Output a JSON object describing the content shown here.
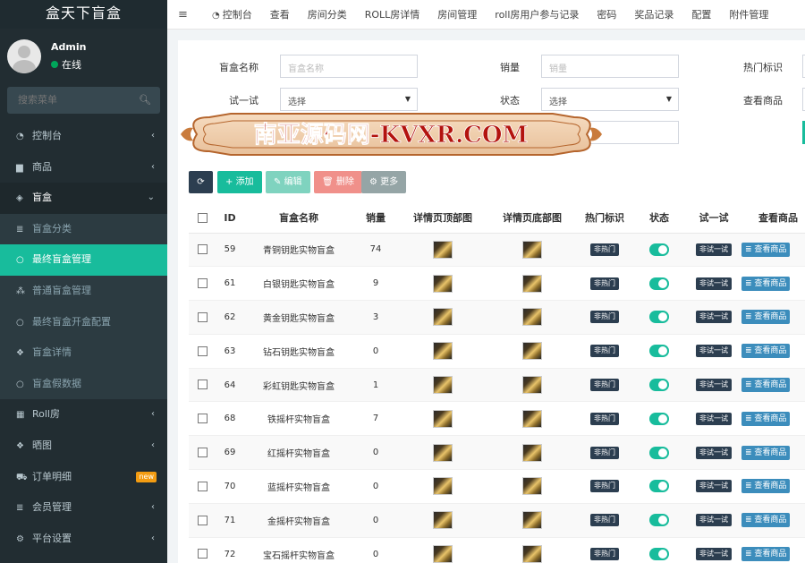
{
  "app": {
    "title": "盒天下盲盒"
  },
  "user": {
    "name": "Admin",
    "status": "在线"
  },
  "search": {
    "placeholder": "搜索菜单"
  },
  "sidebar": {
    "items": [
      {
        "label": "控制台",
        "icon": "dashboard-icon"
      },
      {
        "label": "商品",
        "icon": "shopping-bag-icon"
      },
      {
        "label": "盲盒",
        "icon": "cube-icon"
      },
      {
        "label": "盲盒分类",
        "icon": "list-icon"
      },
      {
        "label": "最终盲盒管理",
        "icon": "circle-icon"
      },
      {
        "label": "普通盲盒管理",
        "icon": "cubes-icon"
      },
      {
        "label": "最终盲盒开盒配置",
        "icon": "circle-icon"
      },
      {
        "label": "盲盒详情",
        "icon": "dropbox-icon"
      },
      {
        "label": "盲盒假数据",
        "icon": "circle-icon"
      },
      {
        "label": "Roll房",
        "icon": "table-icon"
      },
      {
        "label": "晒图",
        "icon": "dropbox-icon"
      },
      {
        "label": "订单明细",
        "icon": "cart-icon",
        "badge": "new"
      },
      {
        "label": "会员管理",
        "icon": "list-icon"
      },
      {
        "label": "平台设置",
        "icon": "gear-icon"
      }
    ]
  },
  "topnav": {
    "items": [
      "控制台",
      "查看",
      "房间分类",
      "ROLL房详情",
      "房间管理",
      "roll房用户参与记录",
      "密码",
      "奖品记录",
      "配置",
      "附件管理"
    ]
  },
  "filters": {
    "name_label": "盲盒名称",
    "name_placeholder": "盲盒名称",
    "sales_label": "销量",
    "sales_placeholder": "销量",
    "hot_label": "热门标识",
    "try_label": "试一试",
    "try_value": "选择",
    "status_label": "状态",
    "status_value": "选择",
    "view_label": "查看商品"
  },
  "toolbar": {
    "add": "添加",
    "edit": "编辑",
    "delete": "删除",
    "more": "更多"
  },
  "toolbar_colors": {
    "refresh": "#2c3e50",
    "add": "#18bc9c",
    "edit": "#7fd3bf",
    "delete": "#f0908a",
    "more": "#95a5a6"
  },
  "table": {
    "headers": [
      "ID",
      "盲盒名称",
      "销量",
      "详情页顶部图",
      "详情页底部图",
      "热门标识",
      "状态",
      "试一试",
      "查看商品"
    ],
    "rows": [
      {
        "id": "59",
        "name": "青铜钥匙实物盲盒",
        "sales": "74",
        "hot": "非热门",
        "try": "非试一试",
        "view": "查看商品"
      },
      {
        "id": "61",
        "name": "白银钥匙实物盲盒",
        "sales": "9",
        "hot": "非热门",
        "try": "非试一试",
        "view": "查看商品"
      },
      {
        "id": "62",
        "name": "黄金钥匙实物盲盒",
        "sales": "3",
        "hot": "非热门",
        "try": "非试一试",
        "view": "查看商品"
      },
      {
        "id": "63",
        "name": "钻石钥匙实物盲盒",
        "sales": "0",
        "hot": "非热门",
        "try": "非试一试",
        "view": "查看商品"
      },
      {
        "id": "64",
        "name": "彩虹钥匙实物盲盒",
        "sales": "1",
        "hot": "非热门",
        "try": "非试一试",
        "view": "查看商品"
      },
      {
        "id": "68",
        "name": "铁摇杆实物盲盒",
        "sales": "7",
        "hot": "非热门",
        "try": "非试一试",
        "view": "查看商品"
      },
      {
        "id": "69",
        "name": "红摇杆实物盲盒",
        "sales": "0",
        "hot": "非热门",
        "try": "非试一试",
        "view": "查看商品"
      },
      {
        "id": "70",
        "name": "蓝摇杆实物盲盒",
        "sales": "0",
        "hot": "非热门",
        "try": "非试一试",
        "view": "查看商品"
      },
      {
        "id": "71",
        "name": "金摇杆实物盲盒",
        "sales": "0",
        "hot": "非热门",
        "try": "非试一试",
        "view": "查看商品"
      },
      {
        "id": "72",
        "name": "宝石摇杆实物盲盒",
        "sales": "0",
        "hot": "非热门",
        "try": "非试一试",
        "view": "查看商品"
      }
    ]
  },
  "watermark": {
    "text": "南亚源码网-KVXR.COM"
  },
  "colors": {
    "sidebar_bg": "#222d32",
    "accent": "#18bc9c",
    "tag_dark": "#2c3e50",
    "view_blue": "#3c8dbc"
  }
}
